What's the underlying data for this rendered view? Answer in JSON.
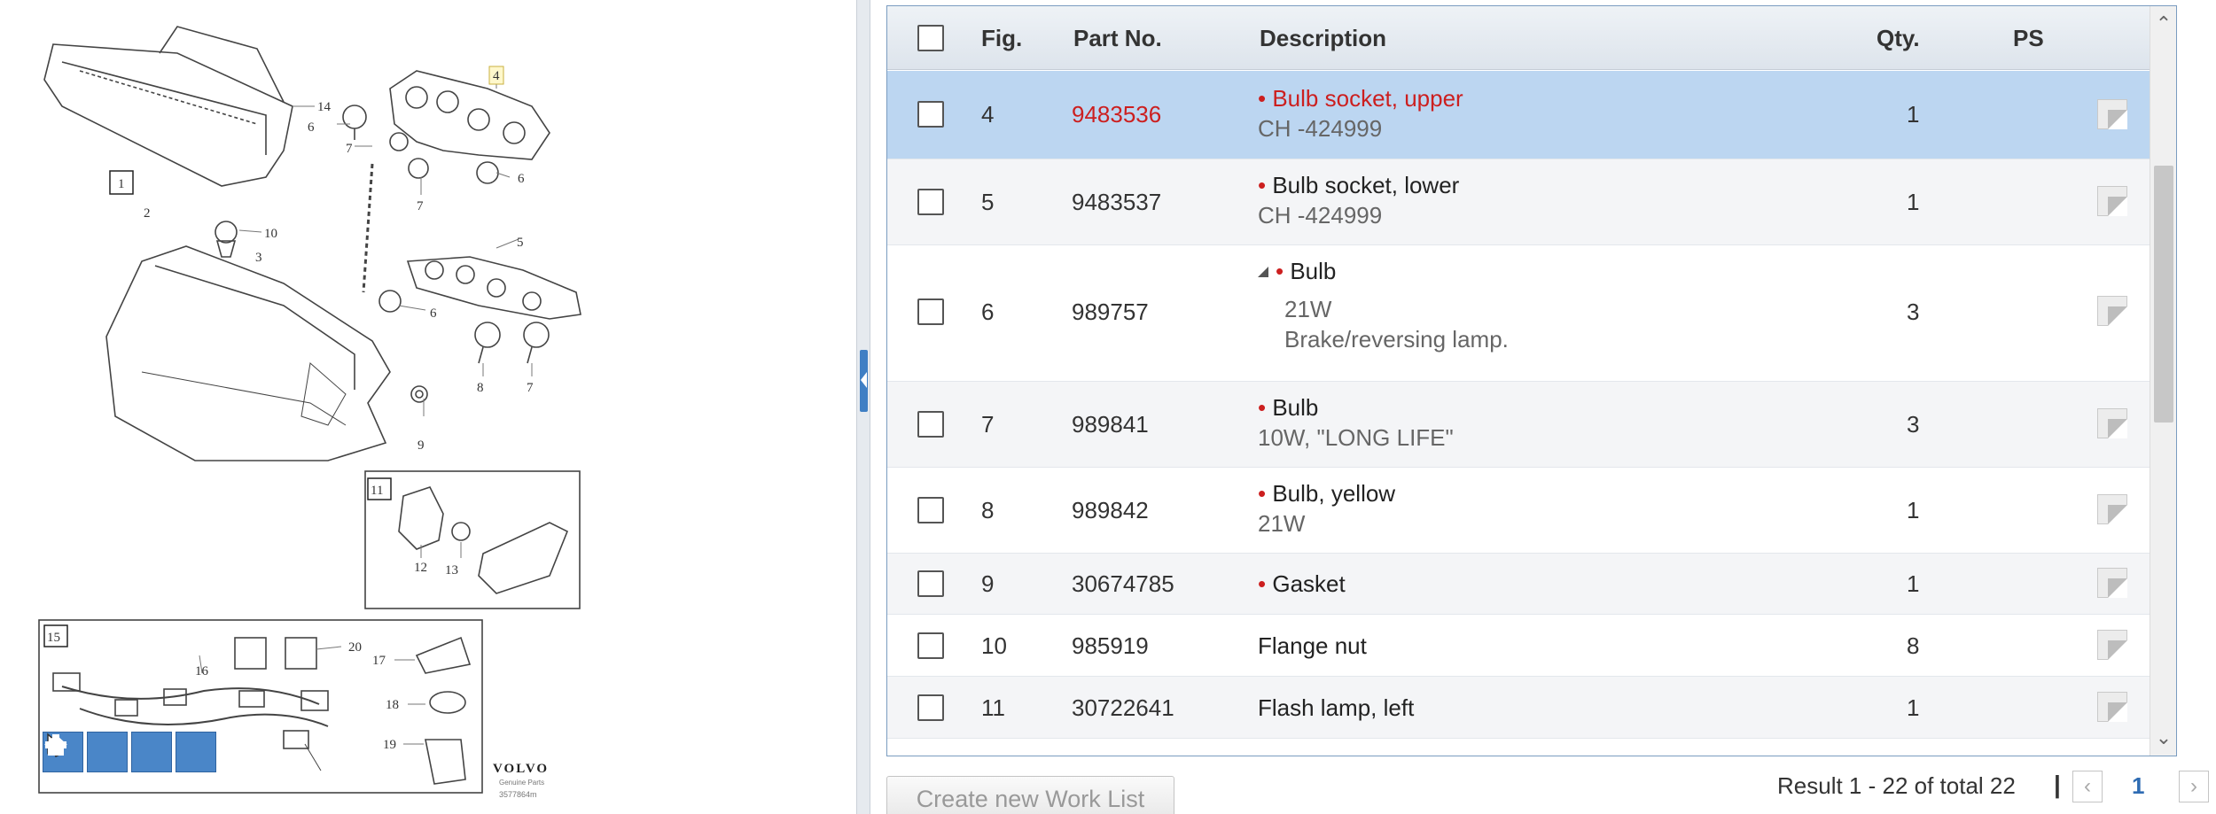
{
  "diagram": {
    "callouts": {
      "c14": "14",
      "c6a": "6",
      "c7a": "7",
      "c4": "4",
      "c6b": "6",
      "c7b": "7",
      "c1": "1",
      "c2": "2",
      "c3": "3",
      "c10": "10",
      "c5": "5",
      "c6c": "6",
      "c8": "8",
      "c7c": "7",
      "c9": "9",
      "c11": "11",
      "c12": "12",
      "c13": "13",
      "c15": "15",
      "c16": "16",
      "c20": "20",
      "c17": "17",
      "c18": "18",
      "c19": "19"
    },
    "brand_logo": "VOLVO",
    "brand_sub": "Genuine Parts",
    "diagram_code": "3577864m"
  },
  "table": {
    "headers": {
      "fig": "Fig.",
      "part_no": "Part No.",
      "description": "Description",
      "qty": "Qty.",
      "ps": "PS"
    },
    "rows": [
      {
        "fig": "4",
        "part_no": "9483536",
        "bullet": "•",
        "desc": "Bulb socket, upper",
        "sub1": "CH -424999",
        "sub2": "",
        "qty": "1"
      },
      {
        "fig": "5",
        "part_no": "9483537",
        "bullet": "•",
        "desc": "Bulb socket, lower",
        "sub1": "CH -424999",
        "sub2": "",
        "qty": "1"
      },
      {
        "fig": "6",
        "part_no": "989757",
        "bullet": "•",
        "desc": "Bulb",
        "sub1": "21W",
        "sub2": "Brake/reversing lamp.",
        "qty": "3"
      },
      {
        "fig": "7",
        "part_no": "989841",
        "bullet": "•",
        "desc": "Bulb",
        "sub1": "10W, \"LONG LIFE\"",
        "sub2": "",
        "qty": "3"
      },
      {
        "fig": "8",
        "part_no": "989842",
        "bullet": "•",
        "desc": "Bulb, yellow",
        "sub1": "21W",
        "sub2": "",
        "qty": "1"
      },
      {
        "fig": "9",
        "part_no": "30674785",
        "bullet": "•",
        "desc": "Gasket",
        "sub1": "",
        "sub2": "",
        "qty": "1"
      },
      {
        "fig": "10",
        "part_no": "985919",
        "bullet": "",
        "desc": "Flange nut",
        "sub1": "",
        "sub2": "",
        "qty": "8"
      },
      {
        "fig": "11",
        "part_no": "30722641",
        "bullet": "",
        "desc": "Flash lamp, left",
        "sub1": "",
        "sub2": "",
        "qty": "1"
      }
    ]
  },
  "footer": {
    "create_worklist": "Create new Work List",
    "result_text": "Result 1 - 22 of total 22",
    "pager_sep": "|",
    "page_number": "1"
  },
  "colors": {
    "selected_row": "#bcd6f1",
    "highlight_red": "#cc1f1f",
    "accent_blue": "#4a86c8"
  }
}
